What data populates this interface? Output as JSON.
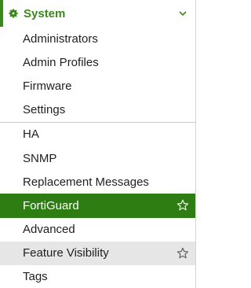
{
  "section": {
    "title": "System",
    "icon": "gear-icon",
    "expand_icon": "chevron-down-icon",
    "accent_color": "#3a8a1a"
  },
  "groups": [
    {
      "items": [
        {
          "label": "Administrators"
        },
        {
          "label": "Admin Profiles"
        },
        {
          "label": "Firmware"
        },
        {
          "label": "Settings"
        }
      ]
    },
    {
      "items": [
        {
          "label": "HA"
        },
        {
          "label": "SNMP"
        },
        {
          "label": "Replacement Messages"
        },
        {
          "label": "FortiGuard",
          "state": "active",
          "favorite_icon": "star-icon"
        },
        {
          "label": "Advanced"
        },
        {
          "label": "Feature Visibility",
          "state": "hover",
          "favorite_icon": "star-icon"
        },
        {
          "label": "Tags"
        }
      ]
    }
  ],
  "colors": {
    "active_bg": "#2e7d12",
    "hover_bg": "#e6e6e6"
  }
}
